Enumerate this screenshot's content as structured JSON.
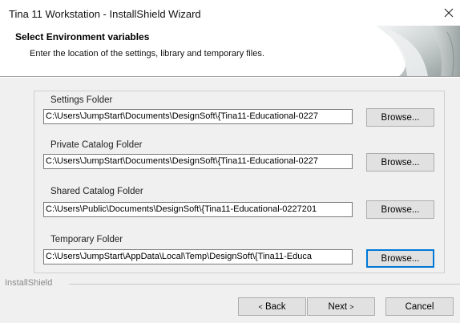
{
  "window": {
    "title": "Tina 11 Workstation - InstallShield Wizard"
  },
  "header": {
    "title": "Select Environment variables",
    "subtitle": "Enter the location of the settings, library and temporary files."
  },
  "fields": [
    {
      "label": "Settings Folder",
      "value": "C:\\Users\\JumpStart\\Documents\\DesignSoft\\{Tina11-Educational-0227",
      "browse_label": "Browse..."
    },
    {
      "label": "Private Catalog Folder",
      "value": "C:\\Users\\JumpStart\\Documents\\DesignSoft\\{Tina11-Educational-0227",
      "browse_label": "Browse..."
    },
    {
      "label": "Shared Catalog Folder",
      "value": "C:\\Users\\Public\\Documents\\DesignSoft\\{Tina11-Educational-0227201",
      "browse_label": "Browse..."
    },
    {
      "label": "Temporary Folder",
      "value": "C:\\Users\\JumpStart\\AppData\\Local\\Temp\\DesignSoft\\{Tina11-Educa",
      "browse_label": "Browse..."
    }
  ],
  "footer": {
    "brand": "InstallShield",
    "back_label": "Back",
    "next_label": "Next",
    "cancel_label": "Cancel"
  },
  "icons": {
    "close": "close-icon",
    "back": "chevron-left-icon",
    "next": "chevron-right-icon",
    "header_art": "installshield-header-graphic"
  },
  "colors": {
    "focus_border": "#0078d7",
    "dialog_bg": "#f0f0f0"
  }
}
